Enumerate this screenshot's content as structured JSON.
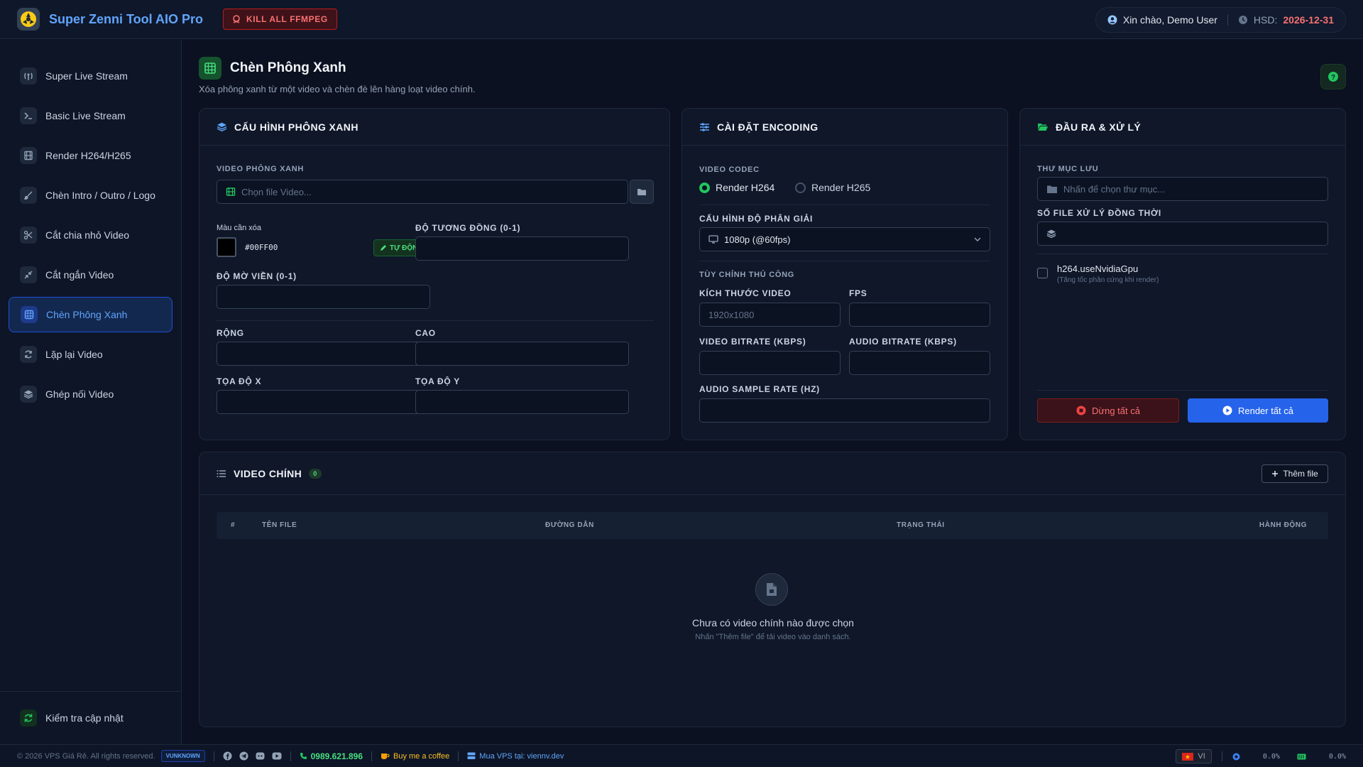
{
  "header": {
    "app_title": "Super Zenni Tool AIO Pro",
    "kill_label": "KILL ALL FFMPEG",
    "greeting": "Xin chào, Demo User",
    "hsd_label": "HSD:",
    "hsd_date": "2026-12-31"
  },
  "sidebar": {
    "items": [
      {
        "label": "Super Live Stream",
        "icon": "antenna-icon"
      },
      {
        "label": "Basic Live Stream",
        "icon": "terminal-icon"
      },
      {
        "label": "Render H264/H265",
        "icon": "film-icon"
      },
      {
        "label": "Chèn Intro / Outro / Logo",
        "icon": "brush-icon"
      },
      {
        "label": "Cắt chia nhỏ Video",
        "icon": "scissors-icon"
      },
      {
        "label": "Cắt ngắn Video",
        "icon": "compress-icon"
      },
      {
        "label": "Chèn Phông Xanh",
        "icon": "chroma-icon",
        "active": true
      },
      {
        "label": "Lặp lại Video",
        "icon": "repeat-icon"
      },
      {
        "label": "Ghép nối Video",
        "icon": "layers-icon"
      }
    ],
    "update_label": "Kiểm tra cập nhật"
  },
  "page": {
    "title": "Chèn Phông Xanh",
    "subtitle": "Xóa phông xanh từ một video và chèn đè lên hàng loạt video chính."
  },
  "greenscreen": {
    "heading": "CẤU HÌNH PHÔNG XANH",
    "video_label": "VIDEO PHÔNG XANH",
    "video_placeholder": "Chọn file Video...",
    "color_label": "Màu cần xóa",
    "color_value": "#00FF00",
    "auto_label": "TỰ ĐỘNG",
    "similarity_label": "ĐỘ TƯƠNG ĐỒNG (0-1)",
    "blend_label": "ĐỘ MỜ VIỀN (0-1)",
    "width_label": "RỘNG",
    "height_label": "CAO",
    "x_label": "TỌA ĐỘ X",
    "y_label": "TỌA ĐỘ Y"
  },
  "encoding": {
    "heading": "CÀI ĐẶT ENCODING",
    "codec_label": "VIDEO CODEC",
    "codec_options": [
      "Render H264",
      "Render H265"
    ],
    "codec_selected": "Render H264",
    "resolution_label": "CẤU HÌNH ĐỘ PHÂN GIẢI",
    "resolution_value": "1080p (@60fps)",
    "custom_label": "TÙY CHỈNH THỦ CÔNG",
    "size_label": "KÍCH THƯỚC VIDEO",
    "size_placeholder": "1920x1080",
    "fps_label": "FPS",
    "vbitrate_label": "VIDEO BITRATE (KBPS)",
    "abitrate_label": "AUDIO BITRATE (KBPS)",
    "samplerate_label": "AUDIO SAMPLE RATE (HZ)"
  },
  "output": {
    "heading": "ĐẦU RA & XỬ LÝ",
    "folder_label": "THƯ MỤC LƯU",
    "folder_placeholder": "Nhấn để chọn thư mục...",
    "concurrent_label": "SỐ FILE XỬ LÝ ĐỒNG THỜI",
    "gpu_label": "h264.useNvidiaGpu",
    "gpu_hint": "(Tăng tốc phần cứng khi render)",
    "stop_label": "Dừng tất cả",
    "render_label": "Render tất cả"
  },
  "videos": {
    "heading": "VIDEO CHÍNH",
    "count": "0",
    "add_label": "Thêm file",
    "columns": [
      "#",
      "TÊN FILE",
      "ĐƯỜNG DẪN",
      "TRẠNG THÁI",
      "HÀNH ĐỘNG"
    ],
    "empty_title": "Chưa có video chính nào được chọn",
    "empty_hint": "Nhấn \"Thêm file\" để tải video vào danh sách."
  },
  "footer": {
    "copyright": "© 2026 VPS Giá Rẻ. All rights reserved.",
    "tag": "VUNKNOWN",
    "phone": "0989.621.896",
    "coffee": "Buy me a coffee",
    "vps": "Mua VPS tại: viennv.dev",
    "lang": "VI",
    "cpu": "0.0%",
    "ram": "0.0%"
  },
  "colors": {
    "accent_blue": "#2563eb",
    "accent_green": "#22c55e",
    "danger": "#ef4444",
    "background": "#0b1120"
  }
}
